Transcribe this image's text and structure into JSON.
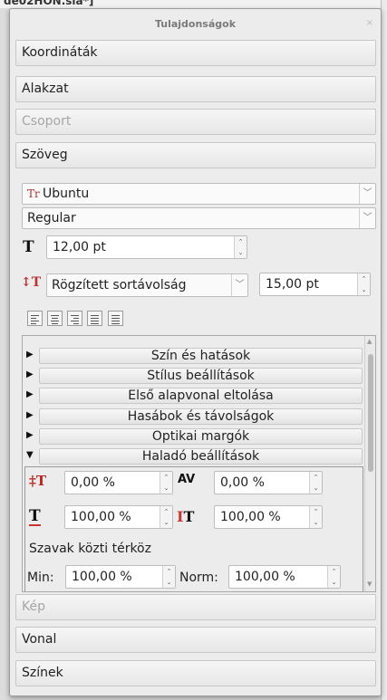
{
  "background": {
    "title": "de02HON.sla*]"
  },
  "panel": {
    "title": "Tulajdonságok",
    "close": "×",
    "sections_top": [
      {
        "label": "Koordináták",
        "enabled": true
      },
      {
        "label": "Alakzat",
        "enabled": true
      },
      {
        "label": "Csoport",
        "enabled": false
      },
      {
        "label": "Szöveg",
        "enabled": true
      }
    ],
    "font": {
      "family": "Ubuntu",
      "style": "Regular"
    },
    "size": {
      "value": "12,00 pt"
    },
    "line_spacing": {
      "mode": "Rögzített sortávolság",
      "value": "15,00 pt"
    },
    "tree": [
      {
        "label": "Szín és hatások",
        "expanded": false
      },
      {
        "label": "Stílus beállítások",
        "expanded": false
      },
      {
        "label": "Első alapvonal eltolása",
        "expanded": false
      },
      {
        "label": "Hasábok és távolságok",
        "expanded": false
      },
      {
        "label": "Optikai margók",
        "expanded": false
      },
      {
        "label": "Haladó beállítások",
        "expanded": true
      }
    ],
    "advanced": {
      "baseline_offset": "0,00 %",
      "tracking": "0,00 %",
      "scale_h": "100,00 %",
      "scale_v": "100,00 %",
      "word_spacing_label": "Szavak közti térköz",
      "min_label": "Min:",
      "min_value": "100,00 %",
      "norm_label": "Norm:",
      "norm_value": "100,00 %"
    },
    "sections_bottom": [
      {
        "label": "Kép",
        "enabled": false
      },
      {
        "label": "Vonal",
        "enabled": true
      },
      {
        "label": "Színek",
        "enabled": true
      }
    ]
  }
}
